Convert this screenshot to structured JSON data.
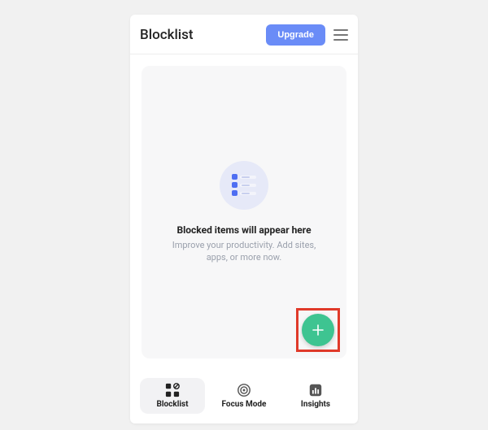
{
  "header": {
    "title": "Blocklist",
    "upgrade_label": "Upgrade"
  },
  "empty": {
    "title": "Blocked items will appear here",
    "subtitle": "Improve your productivity. Add sites, apps, or more now."
  },
  "tabs": {
    "blocklist": "Blocklist",
    "focus": "Focus Mode",
    "insights": "Insights"
  }
}
